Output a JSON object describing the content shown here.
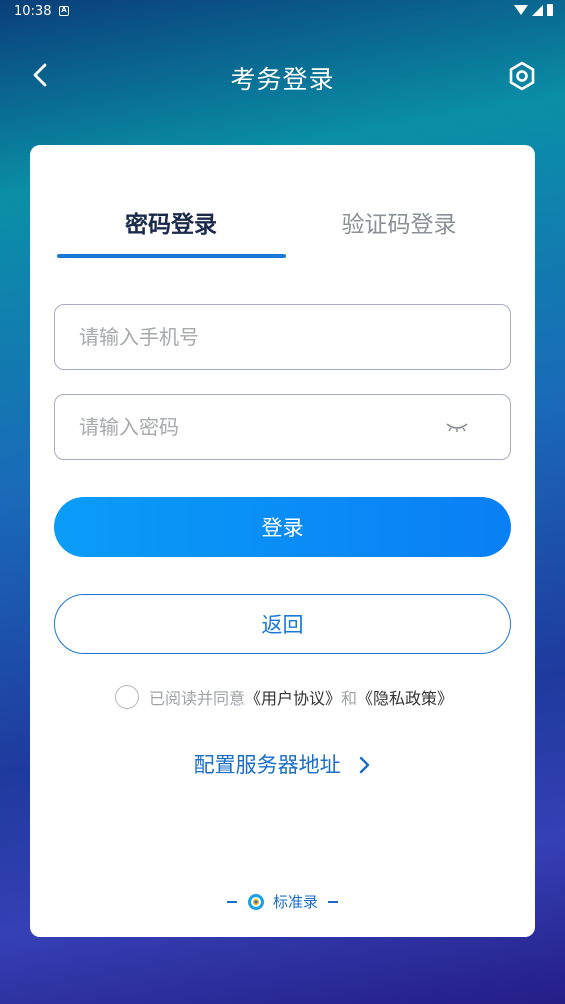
{
  "status_bar": {
    "time": "10:38",
    "notif_icon": "A"
  },
  "nav": {
    "title": "考务登录",
    "back_icon": "back-arrow-icon",
    "settings_icon": "hex-settings-icon"
  },
  "tabs": {
    "password_login": "密码登录",
    "code_login": "验证码登录"
  },
  "form": {
    "phone_placeholder": "请输入手机号",
    "phone_value": "",
    "password_placeholder": "请输入密码",
    "password_value": "",
    "eye_icon": "eye-closed-icon"
  },
  "buttons": {
    "login": "登录",
    "return": "返回"
  },
  "agreement": {
    "prefix": "已阅读并同意",
    "user_agreement": "《用户协议》",
    "and": "和",
    "privacy_policy": "《隐私政策》",
    "checked": false
  },
  "config": {
    "label": "配置服务器地址"
  },
  "footer": {
    "brand": "标准录"
  },
  "colors": {
    "accent": "#1a78d8",
    "link": "#1a6ec8",
    "button_start": "#0a9cf7",
    "button_end": "#0a7ff5"
  }
}
